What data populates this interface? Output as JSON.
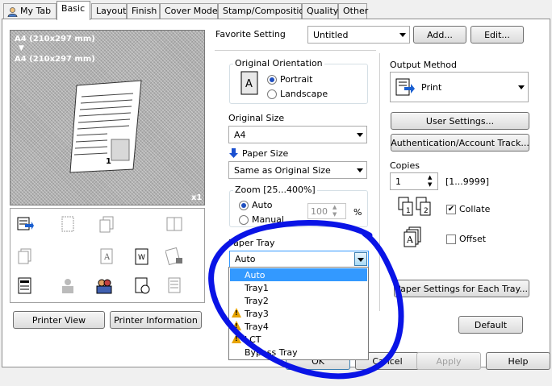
{
  "tabs": [
    "My Tab",
    "Basic",
    "Layout",
    "Finish",
    "Cover Mode",
    "Stamp/Composition",
    "Quality",
    "Other"
  ],
  "preview": {
    "line1": "A4 (210x297 mm)",
    "arrow": "▼",
    "line2": "A4 (210x297 mm)",
    "page_number": "1",
    "scale": "x1"
  },
  "left_buttons": {
    "printer_view": "Printer View",
    "printer_info": "Printer Information"
  },
  "favorite": {
    "label": "Favorite Setting",
    "value": "Untitled",
    "add": "Add...",
    "edit": "Edit..."
  },
  "orientation": {
    "title": "Original Orientation",
    "portrait": "Portrait",
    "landscape": "Landscape"
  },
  "original_size": {
    "label": "Original Size",
    "value": "A4"
  },
  "paper_size": {
    "label": "Paper Size",
    "value": "Same as Original Size"
  },
  "zoom": {
    "title": "Zoom [25...400%]",
    "auto": "Auto",
    "manual": "Manual",
    "value": "100",
    "unit": "%"
  },
  "paper_tray": {
    "label": "Paper Tray",
    "value": "Auto",
    "options": [
      "Auto",
      "Tray1",
      "Tray2",
      "Tray3",
      "Tray4",
      "LCT",
      "Bypass Tray"
    ]
  },
  "output": {
    "label": "Output Method",
    "value": "Print"
  },
  "right_buttons": {
    "user_settings": "User Settings...",
    "auth": "Authentication/Account Track...",
    "paper_settings": "Paper Settings for Each Tray...",
    "default": "Default"
  },
  "copies": {
    "label": "Copies",
    "value": "1",
    "range": "[1...9999]",
    "collate": "Collate",
    "offset": "Offset"
  },
  "bottom": {
    "ok": "OK",
    "cancel": "Cancel",
    "apply": "Apply",
    "help": "Help"
  },
  "colors": {
    "selection": "#3399ff",
    "annotation": "#0a14e6"
  }
}
